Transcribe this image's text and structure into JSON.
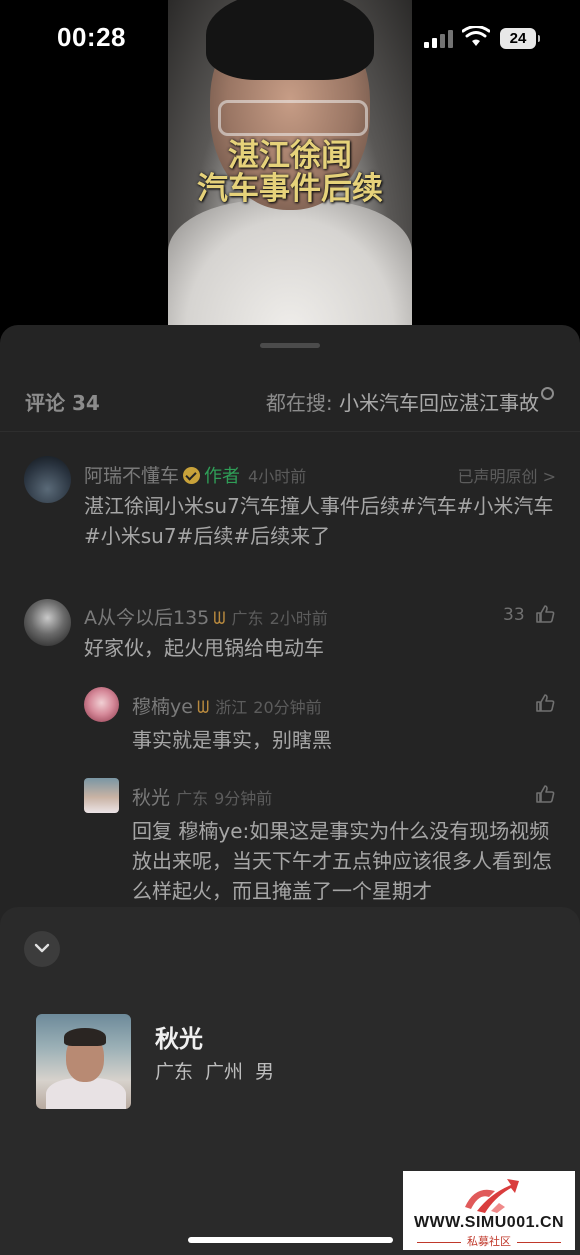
{
  "status_bar": {
    "time": "00:28",
    "battery": "24"
  },
  "video": {
    "title_line1": "湛江徐闻",
    "title_line2": "汽车事件后续"
  },
  "comments_header": {
    "title": "评论 34",
    "search_prefix": "都在搜: ",
    "search_keyword": "小米汽车回应湛江事故"
  },
  "author_post": {
    "name": "阿瑞不懂车",
    "tag": "作者",
    "time": "4小时前",
    "original": "已声明原创 >",
    "text": "湛江徐闻小米su7汽车撞人事件后续#汽车#小米汽车#小米su7#后续#后续来了"
  },
  "comments": [
    {
      "name": "A从今以后135",
      "location": "广东",
      "time": "2小时前",
      "likes": "33",
      "text": "好家伙，起火甩锅给电动车"
    },
    {
      "name": "穆楠ye",
      "location": "浙江",
      "time": "20分钟前",
      "text": "事实就是事实，别瞎黑"
    },
    {
      "name": "秋光",
      "location": "广东",
      "time": "9分钟前",
      "reply_prefix": "回复 ",
      "reply_to": "穆楠ye",
      "text": ":如果这是事实为什么没有现场视频放出来呢，当天下午才五点钟应该很多人看到怎么样起火，而且掩盖了一个星期才"
    }
  ],
  "profile_card": {
    "name": "秋光",
    "info": "广东 广州 男"
  },
  "watermark": {
    "url": "WWW.SIMU001.CN",
    "sub": "私募社区"
  }
}
